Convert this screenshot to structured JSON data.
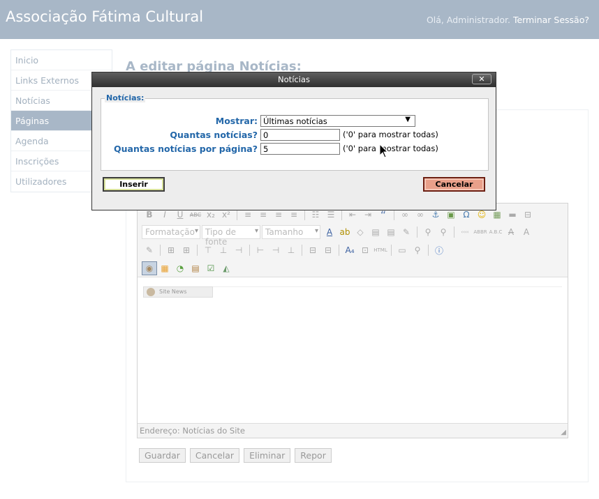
{
  "header": {
    "title": "Associação Fátima Cultural",
    "greeting": "Olá, Administrador.",
    "logout": "Terminar Sessão?"
  },
  "sidebar": {
    "items": [
      {
        "label": "Inicio"
      },
      {
        "label": "Links Externos"
      },
      {
        "label": "Notícias"
      },
      {
        "label": "Páginas",
        "active": true
      },
      {
        "label": "Agenda"
      },
      {
        "label": "Inscrições"
      },
      {
        "label": "Utilizadores"
      }
    ]
  },
  "main": {
    "heading": "A editar página Notícias:"
  },
  "editor": {
    "format_combo": "Formatação",
    "font_combo": "Tipo de fonte",
    "size_combo": "Tamanho",
    "site_news_label": "Site News",
    "status": "Endereço: Notícias do Site"
  },
  "form_buttons": {
    "save": "Guardar",
    "cancel": "Cancelar",
    "delete": "Eliminar",
    "reset": "Repor"
  },
  "modal": {
    "title": "Notícias",
    "close": "✕",
    "legend": "Notícias:",
    "show_label": "Mostrar:",
    "show_value": "Últimas notícias",
    "count_label": "Quantas notícias?",
    "count_value": "0",
    "count_hint": "('0' para mostrar todas)",
    "per_page_label": "Quantas notícias por página?",
    "per_page_value": "5",
    "per_page_hint": "('0' para mostrar todas)",
    "insert": "Inserir",
    "cancel": "Cancelar"
  },
  "colors": {
    "header_bg": "#a8b7c7",
    "label_blue": "#2367a9",
    "cancel_bg": "#e9a08a"
  }
}
